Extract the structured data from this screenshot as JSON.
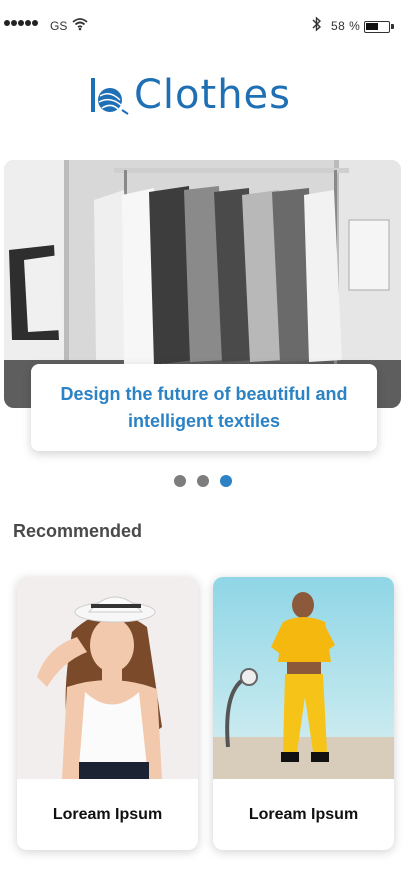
{
  "status_bar": {
    "carrier": "GS",
    "battery_percent": "58 %",
    "icons": [
      "signal-dots-icon",
      "wifi-icon",
      "bluetooth-icon",
      "battery-icon"
    ]
  },
  "brand": {
    "name": "IoClothes",
    "color": "#1f6fb5"
  },
  "hero": {
    "caption": "Design the future of beautiful and intelligent textiles",
    "accent_color": "#2b82c4"
  },
  "carousel": {
    "total": 3,
    "active_index": 2
  },
  "recommended": {
    "title": "Recommended",
    "items": [
      {
        "label": "Loream Ipsum"
      },
      {
        "label": "Loream Ipsum"
      }
    ]
  }
}
